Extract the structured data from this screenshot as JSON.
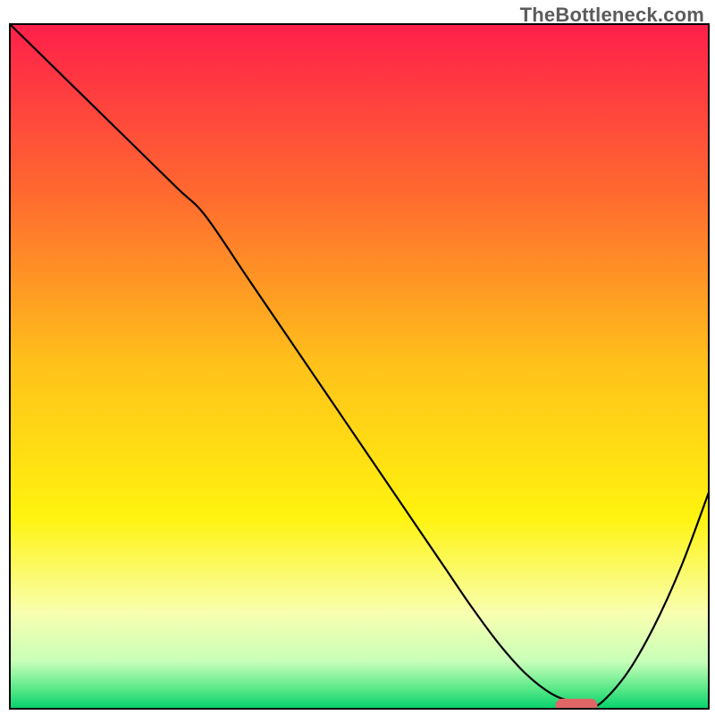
{
  "watermark": "TheBottleneck.com",
  "chart_data": {
    "type": "line",
    "title": "",
    "xlabel": "",
    "ylabel": "",
    "xlim": [
      0,
      100
    ],
    "ylim": [
      0,
      100
    ],
    "grid": false,
    "legend": false,
    "background_gradient_stops": [
      {
        "offset": 0.0,
        "color": "#ff1f4b"
      },
      {
        "offset": 0.25,
        "color": "#ff6a2f"
      },
      {
        "offset": 0.5,
        "color": "#ffc21a"
      },
      {
        "offset": 0.72,
        "color": "#fff30f"
      },
      {
        "offset": 0.86,
        "color": "#f8ffb0"
      },
      {
        "offset": 0.93,
        "color": "#c8ffb8"
      },
      {
        "offset": 0.97,
        "color": "#58e888"
      },
      {
        "offset": 1.0,
        "color": "#00d06a"
      }
    ],
    "series": [
      {
        "name": "bottleneck-curve",
        "stroke": "#000000",
        "stroke_width": 2.2,
        "x": [
          0,
          8,
          16,
          24,
          28,
          34,
          40,
          48,
          56,
          62,
          66,
          70,
          74,
          78,
          82,
          84,
          88,
          92,
          96,
          100
        ],
        "y": [
          100,
          92,
          84,
          76,
          72,
          63,
          54,
          42,
          30,
          21,
          15,
          9.5,
          5,
          2,
          0.8,
          0.6,
          5,
          12,
          21,
          32
        ]
      }
    ],
    "marker": {
      "name": "optimal-marker",
      "color": "#e06666",
      "x_start": 78,
      "x_end": 84,
      "y": 0.6,
      "thickness": 2
    },
    "axes": {
      "frame_color": "#000000",
      "frame_width": 2
    }
  }
}
